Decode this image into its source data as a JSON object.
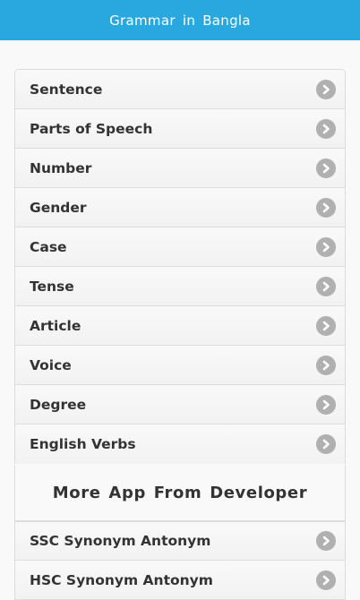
{
  "header": {
    "title": "Grammar in Bangla"
  },
  "topics": [
    {
      "label": "Sentence"
    },
    {
      "label": "Parts of Speech"
    },
    {
      "label": "Number"
    },
    {
      "label": "Gender"
    },
    {
      "label": "Case"
    },
    {
      "label": "Tense"
    },
    {
      "label": "Article"
    },
    {
      "label": "Voice"
    },
    {
      "label": "Degree"
    },
    {
      "label": "English Verbs"
    }
  ],
  "more_apps": {
    "title": "More App From Developer",
    "items": [
      {
        "label": "SSC Synonym Antonym"
      },
      {
        "label": "HSC Synonym Antonym"
      }
    ]
  },
  "colors": {
    "header_bg": "#29a8e0",
    "arrow_bg": "#b0b0b0"
  },
  "icons": {
    "item_arrow": "chevron-right-circle-icon"
  }
}
